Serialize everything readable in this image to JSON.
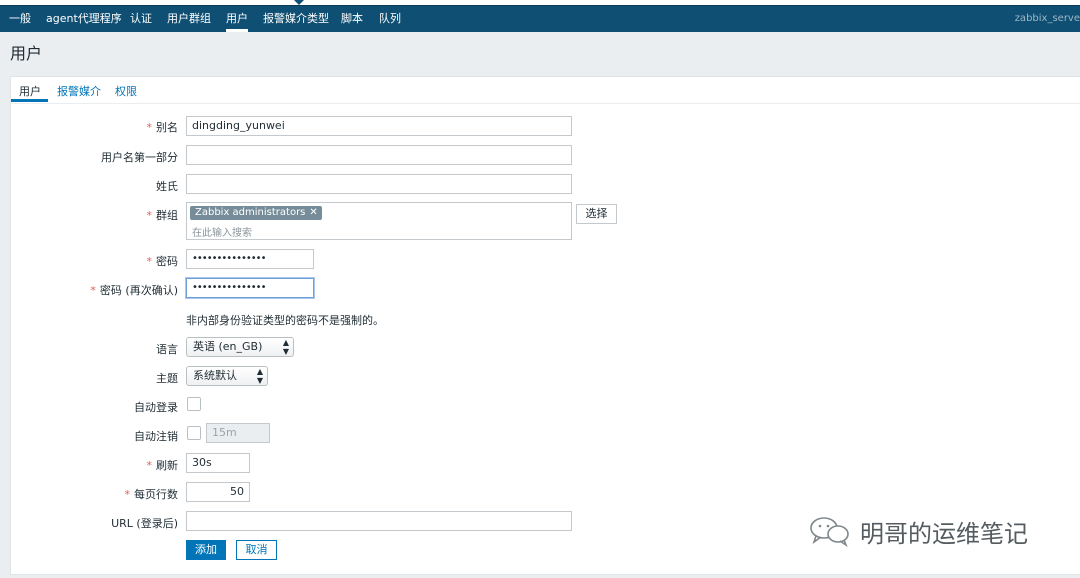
{
  "nav": {
    "items": [
      "一般",
      "agent代理程序",
      "认证",
      "用户群组",
      "用户",
      "报警媒介类型",
      "脚本",
      "队列"
    ],
    "active": "用户",
    "server": "zabbix_serve"
  },
  "page": {
    "title": "用户"
  },
  "tabs": [
    "用户",
    "报警媒介",
    "权限"
  ],
  "form": {
    "alias": {
      "label": "别名",
      "value": "dingding_yunwei"
    },
    "name": {
      "label": "用户名第一部分",
      "value": ""
    },
    "surname": {
      "label": "姓氏",
      "value": ""
    },
    "groups": {
      "label": "群组",
      "chip": "Zabbix administrators",
      "placeholder": "在此输入搜索",
      "select_button": "选择"
    },
    "password": {
      "label": "密码",
      "value": "•••••••••••••••"
    },
    "password_confirm": {
      "label": "密码 (再次确认)",
      "value": "•••••••••••••••"
    },
    "password_hint": "非内部身份验证类型的密码不是强制的。",
    "language": {
      "label": "语言",
      "value": "英语 (en_GB)"
    },
    "theme": {
      "label": "主题",
      "value": "系统默认"
    },
    "autologin": {
      "label": "自动登录",
      "checked": false
    },
    "autologout": {
      "label": "自动注销",
      "checked": false,
      "value": "15m"
    },
    "refresh": {
      "label": "刷新",
      "value": "30s"
    },
    "rows_per_page": {
      "label": "每页行数",
      "value": "50"
    },
    "url": {
      "label": "URL (登录后)",
      "value": ""
    }
  },
  "buttons": {
    "add": "添加",
    "cancel": "取消"
  },
  "required_mark": "*",
  "watermark": "明哥的运维笔记"
}
